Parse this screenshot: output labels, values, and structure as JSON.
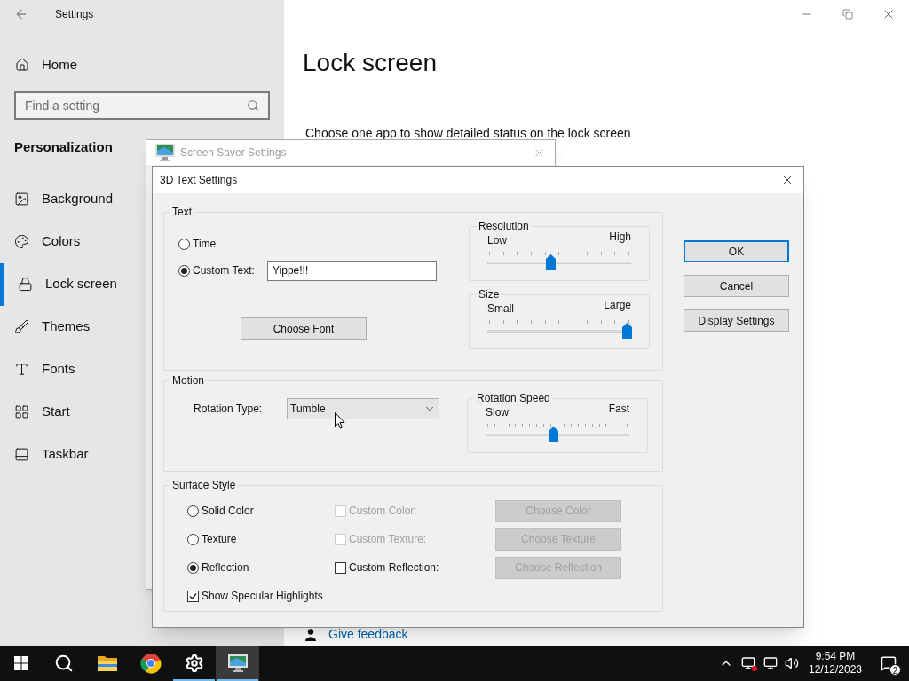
{
  "settings_window": {
    "title": "Settings",
    "home": "Home",
    "search": {
      "placeholder": "Find a setting"
    },
    "section": "Personalization",
    "nav": [
      {
        "label": "Background",
        "selected": false
      },
      {
        "label": "Colors",
        "selected": false
      },
      {
        "label": "Lock screen",
        "selected": true
      },
      {
        "label": "Themes",
        "selected": false
      },
      {
        "label": "Fonts",
        "selected": false
      },
      {
        "label": "Start",
        "selected": false
      },
      {
        "label": "Taskbar",
        "selected": false
      }
    ]
  },
  "page": {
    "title": "Lock screen",
    "description": "Choose one app to show detailed status on the lock screen",
    "feedback_link": "Give feedback"
  },
  "screen_saver_window": {
    "title": "Screen Saver Settings"
  },
  "dialog": {
    "title": "3D Text Settings",
    "text_group": {
      "legend": "Text",
      "options": [
        {
          "label": "Time",
          "selected": false
        },
        {
          "label": "Custom Text:",
          "selected": true
        }
      ],
      "custom_text": {
        "value": "Yippe!!!"
      },
      "font_button": "Choose Font",
      "sliders": [
        {
          "title": "Resolution",
          "min_label": "Low",
          "max_label": "High",
          "level": 0.44
        },
        {
          "title": "Size",
          "min_label": "Small",
          "max_label": "Large",
          "level": 0.97
        }
      ]
    },
    "motion_group": {
      "legend": "Motion",
      "rotation_type": {
        "label": "Rotation Type:",
        "value": "Tumble"
      },
      "slider": {
        "title": "Rotation Speed",
        "min_label": "Slow",
        "max_label": "Fast",
        "level": 0.47
      }
    },
    "surface_group": {
      "legend": "Surface Style",
      "options": [
        {
          "label": "Solid Color",
          "selected": false,
          "custom": {
            "label": "Custom Color:",
            "checked": false,
            "disabled": true
          },
          "button": {
            "label": "Choose Color",
            "disabled": true
          }
        },
        {
          "label": "Texture",
          "selected": false,
          "custom": {
            "label": "Custom Texture:",
            "checked": false,
            "disabled": true
          },
          "button": {
            "label": "Choose Texture",
            "disabled": true
          }
        },
        {
          "label": "Reflection",
          "selected": true,
          "custom": {
            "label": "Custom Reflection:",
            "checked": false,
            "disabled": false
          },
          "button": {
            "label": "Choose Reflection",
            "disabled": true
          }
        }
      ],
      "specular": {
        "label": "Show Specular Highlights",
        "checked": true
      }
    },
    "buttons": [
      {
        "label": "OK",
        "default": true
      },
      {
        "label": "Cancel",
        "default": false
      },
      {
        "label": "Display Settings",
        "default": false
      }
    ]
  },
  "taskbar": {
    "apps": [
      {
        "kind": "explorer",
        "open": false,
        "selected": false
      },
      {
        "kind": "browser",
        "open": false,
        "selected": false
      },
      {
        "kind": "settings",
        "open": true,
        "selected": false
      },
      {
        "kind": "screensaver",
        "open": true,
        "selected": true
      }
    ],
    "time": "9:54 PM",
    "date": "12/12/2023",
    "notifications": "2"
  }
}
